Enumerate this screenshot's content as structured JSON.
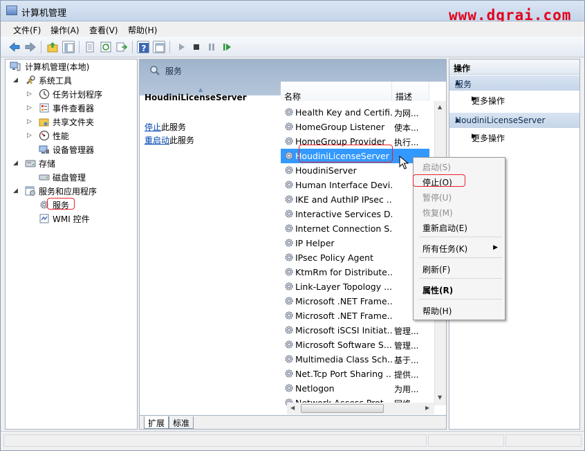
{
  "window": {
    "title": "计算机管理"
  },
  "watermark": "www.dgrai.com",
  "menu": [
    "文件(F)",
    "操作(A)",
    "查看(V)",
    "帮助(H)"
  ],
  "tree": {
    "root": "计算机管理(本地)",
    "system_tools": "系统工具",
    "task_scheduler": "任务计划程序",
    "event_viewer": "事件查看器",
    "shared_folders": "共享文件夹",
    "performance": "性能",
    "device_manager": "设备管理器",
    "storage": "存储",
    "disk_management": "磁盘管理",
    "services_apps": "服务和应用程序",
    "services": "服务",
    "wmi": "WMI 控件"
  },
  "middle": {
    "header": "服务",
    "selected_service": "HoudiniLicenseServer",
    "stop_link": "停止",
    "stop_suffix": "此服务",
    "restart_link": "重启动",
    "restart_suffix": "此服务",
    "columns": {
      "name": "名称",
      "desc": "描述"
    },
    "rows": [
      {
        "name": "Health Key and Certifi...",
        "desc": "为网..."
      },
      {
        "name": "HomeGroup Listener",
        "desc": "使本..."
      },
      {
        "name": "HomeGroup Provider",
        "desc": "执行..."
      },
      {
        "name": "HoudiniLicenseServer",
        "desc": ""
      },
      {
        "name": "HoudiniServer",
        "desc": ""
      },
      {
        "name": "Human Interface Devi...",
        "desc": ""
      },
      {
        "name": "IKE and AuthIP IPsec ...",
        "desc": ""
      },
      {
        "name": "Interactive Services D...",
        "desc": ""
      },
      {
        "name": "Internet Connection S...",
        "desc": ""
      },
      {
        "name": "IP Helper",
        "desc": ""
      },
      {
        "name": "IPsec Policy Agent",
        "desc": ""
      },
      {
        "name": "KtmRm for Distribute...",
        "desc": ""
      },
      {
        "name": "Link-Layer Topology ...",
        "desc": ""
      },
      {
        "name": "Microsoft .NET Frame...",
        "desc": ""
      },
      {
        "name": "Microsoft .NET Frame...",
        "desc": ""
      },
      {
        "name": "Microsoft iSCSI Initiat...",
        "desc": "管理..."
      },
      {
        "name": "Microsoft Software S...",
        "desc": "管理..."
      },
      {
        "name": "Multimedia Class Sch...",
        "desc": "基于..."
      },
      {
        "name": "Net.Tcp Port Sharing ...",
        "desc": "提供..."
      },
      {
        "name": "Netlogon",
        "desc": "为用..."
      },
      {
        "name": "Network Access Prot...",
        "desc": "网络..."
      }
    ],
    "tabs": {
      "extended": "扩展",
      "standard": "标准"
    }
  },
  "actions": {
    "title": "操作",
    "section1": "服务",
    "more1": "更多操作",
    "section2": "HoudiniLicenseServer",
    "more2": "更多操作"
  },
  "context_menu": {
    "start": "启动(S)",
    "stop": "停止(O)",
    "pause": "暂停(U)",
    "resume": "恢复(M)",
    "restart": "重新启动(E)",
    "all_tasks": "所有任务(K)",
    "refresh": "刷新(F)",
    "properties": "属性(R)",
    "help": "帮助(H)"
  }
}
